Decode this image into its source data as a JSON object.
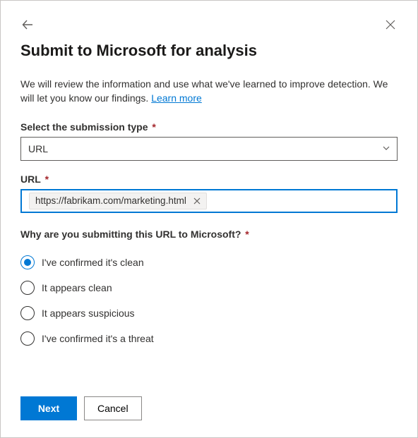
{
  "header": {
    "title": "Submit to Microsoft for analysis"
  },
  "intro": {
    "text": "We will review the information and use what we've learned to improve detection. We will let you know our findings. ",
    "link_label": "Learn more"
  },
  "type_field": {
    "label": "Select the submission type",
    "value": "URL"
  },
  "url_field": {
    "label": "URL",
    "chip_value": "https://fabrikam.com/marketing.html"
  },
  "reason": {
    "label": "Why are you submitting this URL to Microsoft?",
    "options": [
      "I've confirmed it's clean",
      "It appears clean",
      "It appears suspicious",
      "I've confirmed it's a threat"
    ],
    "selected_index": 0
  },
  "footer": {
    "next_label": "Next",
    "cancel_label": "Cancel"
  }
}
